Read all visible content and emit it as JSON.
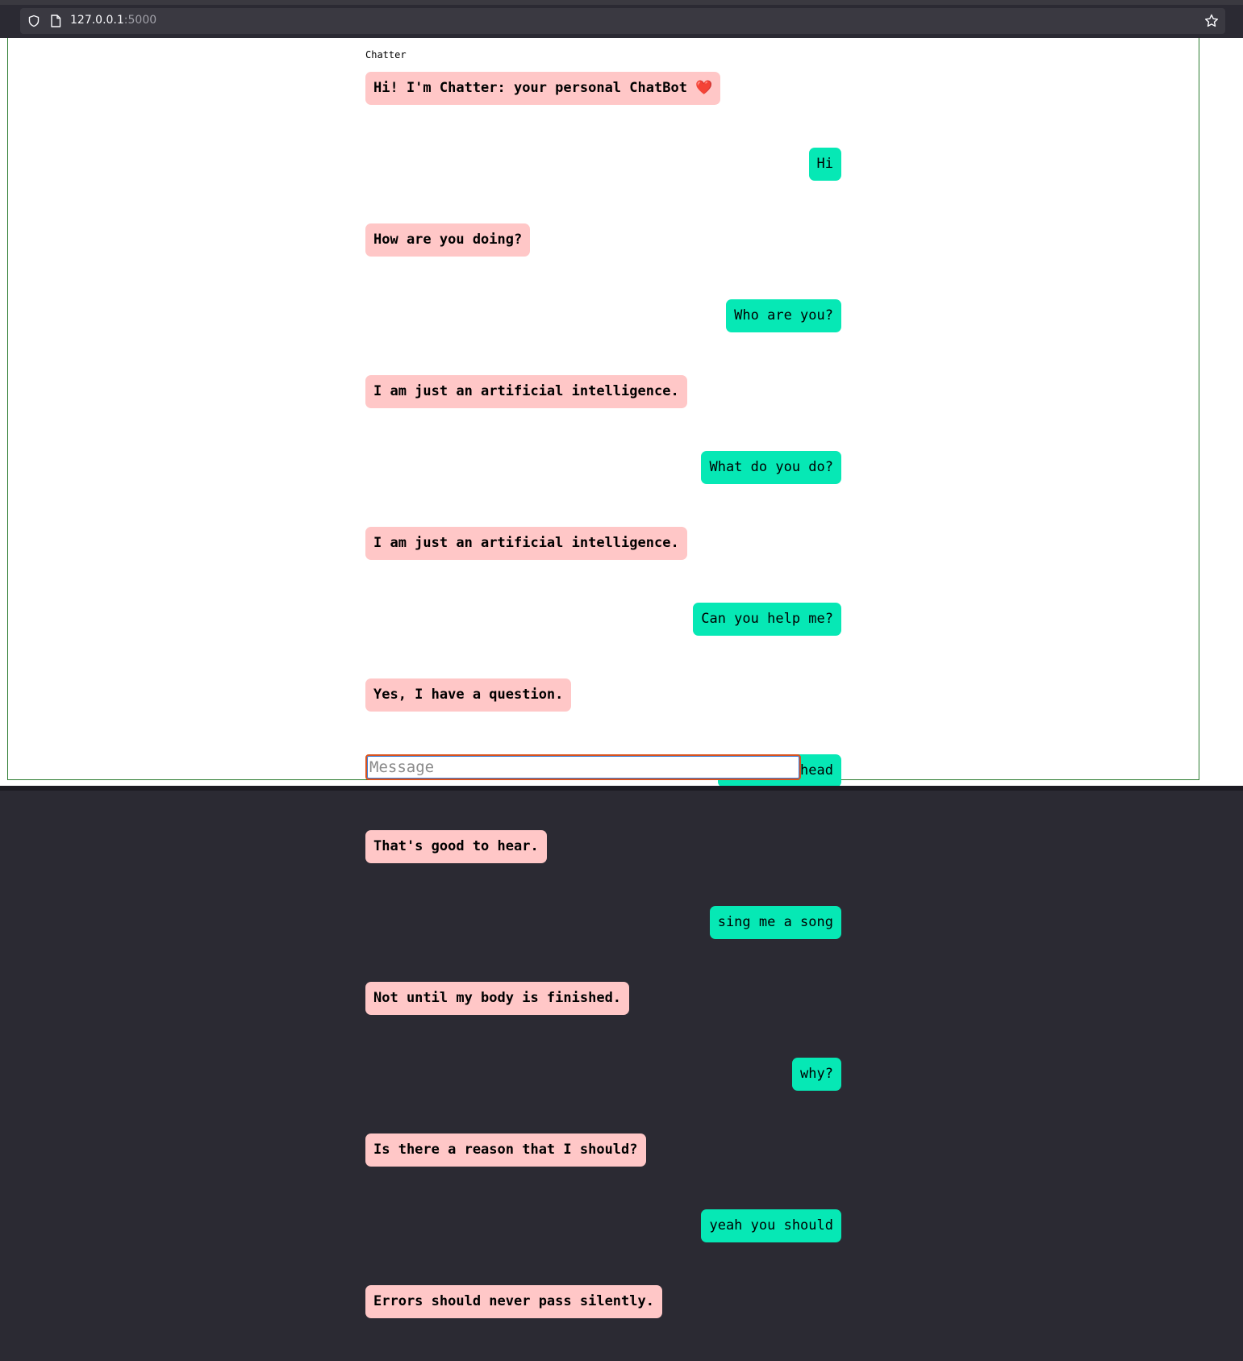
{
  "browser": {
    "url_host": "127.0.0.1",
    "url_port": ":5000"
  },
  "chat": {
    "title": "Chatter",
    "messages": [
      {
        "from": "bot",
        "text": "Hi! I'm Chatter: your personal ChatBot",
        "heart": "❤️"
      },
      {
        "from": "user",
        "text": "Hi"
      },
      {
        "from": "bot",
        "text": "How are you doing?"
      },
      {
        "from": "user",
        "text": "Who are you?"
      },
      {
        "from": "bot",
        "text": "I am just an artificial intelligence."
      },
      {
        "from": "user",
        "text": "What do you do?"
      },
      {
        "from": "bot",
        "text": "I am just an artificial intelligence."
      },
      {
        "from": "user",
        "text": "Can you help me?"
      },
      {
        "from": "bot",
        "text": "Yes, I have a question."
      },
      {
        "from": "user",
        "text": "okay go ahead"
      },
      {
        "from": "bot",
        "text": "That's good to hear."
      },
      {
        "from": "user",
        "text": "sing me a song"
      },
      {
        "from": "bot",
        "text": "Not until my body is finished."
      },
      {
        "from": "user",
        "text": "why?"
      },
      {
        "from": "bot",
        "text": "Is there a reason that I should?"
      },
      {
        "from": "user",
        "text": "yeah you should"
      },
      {
        "from": "bot",
        "text": "Errors should never pass silently."
      }
    ]
  },
  "input": {
    "placeholder": "Message",
    "value": ""
  },
  "colors": {
    "bot_bubble": "#ffc7c7",
    "user_bubble": "#06e8b5",
    "heart": "#e0243a",
    "frame_border": "#2e7d32"
  }
}
